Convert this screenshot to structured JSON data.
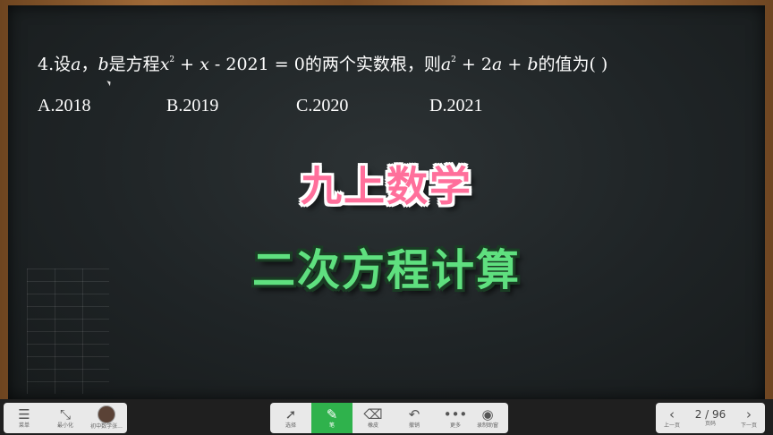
{
  "question": {
    "number": "4.",
    "t1": "设",
    "var_a": "a",
    "comma": "，",
    "var_b": "b",
    "t2": "是方程",
    "x": "x",
    "sup2": "2",
    "t3": " + ",
    "x2": "x",
    "t4": " - 2021 = 0",
    "t5": "的两个实数根，则",
    "a2": "a",
    "sup2b": "2",
    "t6": " + 2",
    "a3": "a",
    "t7": " + ",
    "b2": "b",
    "t8": "的值为(    )"
  },
  "options": [
    "A.2018",
    "B.2019",
    "C.2020",
    "D.2021"
  ],
  "title_main": "九上数学",
  "title_sub": "二次方程计算",
  "toolbar": {
    "left": [
      {
        "icon": "☰",
        "label": "菜单"
      },
      {
        "icon": "⤡",
        "label": "最小化"
      },
      {
        "icon": "",
        "label": "初中数学张..."
      }
    ],
    "center": [
      {
        "icon": "➚",
        "label": "选择"
      },
      {
        "icon": "✎",
        "label": "笔"
      },
      {
        "icon": "⌫",
        "label": "橡皮"
      },
      {
        "icon": "↶",
        "label": "撤销"
      },
      {
        "icon": "•••",
        "label": "更多"
      }
    ],
    "record": {
      "icon": "◉",
      "label": "录制助窗"
    },
    "prev": {
      "icon": "‹",
      "label": "上一页"
    },
    "page": "2 / 96",
    "page_label": "页码",
    "next": {
      "icon": "›",
      "label": "下一页"
    }
  },
  "colors": {
    "title_main": "#ff6f9b",
    "title_sub": "#5fe07f",
    "active_tool": "#2fb24c"
  }
}
